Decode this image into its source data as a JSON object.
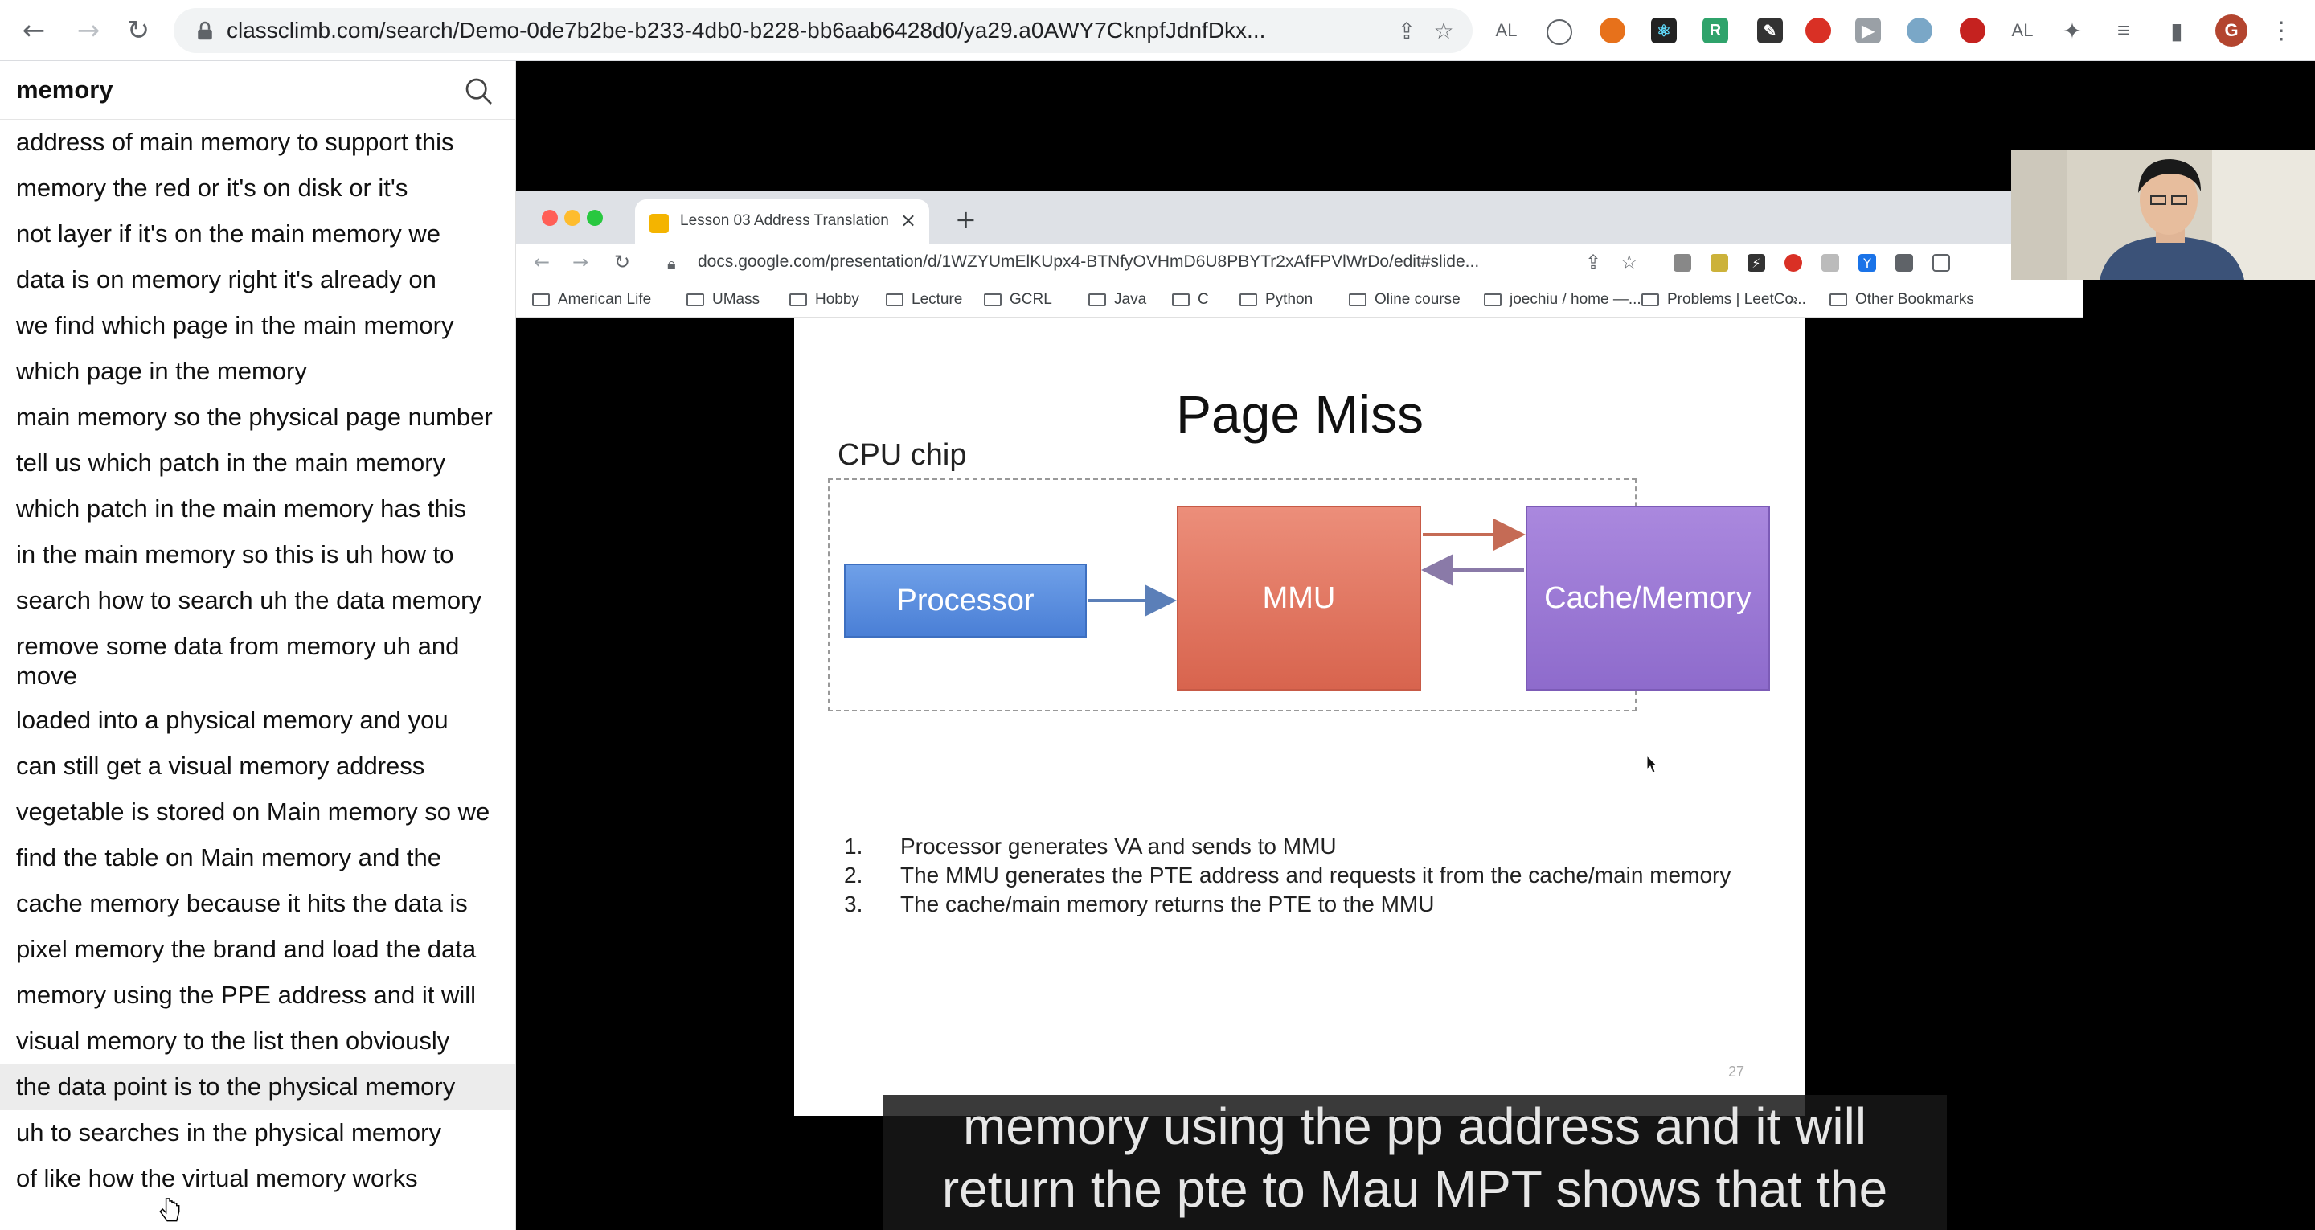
{
  "browser": {
    "url": "classclimb.com/search/Demo-0de7b2be-b233-4db0-b228-bb6aab6428d0/ya29.a0AWY7CknpfJdnfDkx...",
    "extensions": [
      "AL",
      "AL"
    ],
    "profile_initial": "G",
    "accent_colors": {
      "profile": "#b3452f"
    }
  },
  "sidebar": {
    "search_value": "memory",
    "results": [
      "address of main memory to support this",
      "memory the red or it's on disk or it's",
      "not layer if it's on the main memory we",
      "data is on memory right it's already on",
      "we find which page in the main memory",
      "which page in the memory",
      "main memory so the physical page number",
      "tell us which patch in the main memory",
      "which patch in the main memory has this",
      "in the main memory so this is uh how to",
      "search how to search uh the data memory",
      "remove some data from memory uh and move",
      "loaded into a physical memory and you",
      "can still get a visual memory address",
      "vegetable is stored on Main memory so we",
      "find the table on Main memory and the",
      "cache memory because it hits the data is",
      "pixel memory the brand and load the data",
      "memory using the PPE address and it will",
      "visual memory to the list then obviously",
      "the data point is to the physical memory",
      "uh to searches in the physical memory",
      "of like how the virtual memory works"
    ],
    "active_index": 20
  },
  "inner_browser": {
    "tab_title": "Lesson 03 Address Translation",
    "url": "docs.google.com/presentation/d/1WZYUmElKUpx4-BTNfyOVHmD6U8PBYTr2xAfFPVlWrDo/edit#slide...",
    "bookmarks": [
      "American Life",
      "UMass",
      "Hobby",
      "Lecture",
      "GCRL",
      "Java",
      "C",
      "Python",
      "Oline course",
      "joechiu / home —...",
      "Problems | LeetCo...",
      "»",
      "Other Bookmarks"
    ]
  },
  "slide": {
    "title": "Page Miss",
    "cpu_label": "CPU chip",
    "processor": "Processor",
    "mmu": "MMU",
    "cache": "Cache/Memory",
    "steps": [
      {
        "num": "1.",
        "text": "Processor generates VA and sends to MMU"
      },
      {
        "num": "2.",
        "text": "The MMU generates the PTE address and requests it from the cache/main memory"
      },
      {
        "num": "3.",
        "text": "The cache/main memory returns the PTE to the MMU"
      }
    ],
    "page_number": "27"
  },
  "captions": {
    "line1": "memory using the pp address and it will",
    "line2": "return the pte to Mau MPT shows that the"
  }
}
